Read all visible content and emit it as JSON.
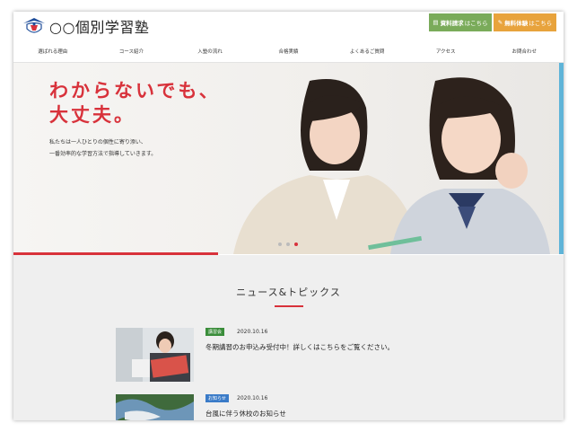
{
  "header": {
    "logo_text": "○○個別学習塾",
    "btn_doc": "資料請求はこちら",
    "btn_doc_strong": "資料請求",
    "btn_doc_rest": "はこちら",
    "btn_trial_strong": "無料体験",
    "btn_trial_rest": "はこちら"
  },
  "nav": [
    "選ばれる理由",
    "コース紹介",
    "入塾の流れ",
    "合格実績",
    "よくあるご質問",
    "アクセス",
    "お問合わせ"
  ],
  "hero": {
    "title_line1": "わからないでも、",
    "title_line2": "大丈夫。",
    "sub_line1": "私たちは一人ひとりの個性に寄り添い、",
    "sub_line2": "一番効率的な学習方法で指導していきます。"
  },
  "news": {
    "title": "ニュース&トピックス",
    "items": [
      {
        "tag": "講習会",
        "tag_color": "#3a8d3a",
        "date": "2020.10.16",
        "text": "冬期講習のお申込み受付中！詳しくはこちらをご覧ください。"
      },
      {
        "tag": "お知らせ",
        "tag_color": "#3a7bc8",
        "date": "2020.10.16",
        "text": "台風に伴う休校のお知らせ"
      }
    ]
  },
  "colors": {
    "accent": "#d8323b",
    "doc_btn": "#7aab5a",
    "trial_btn": "#e8a33c"
  }
}
